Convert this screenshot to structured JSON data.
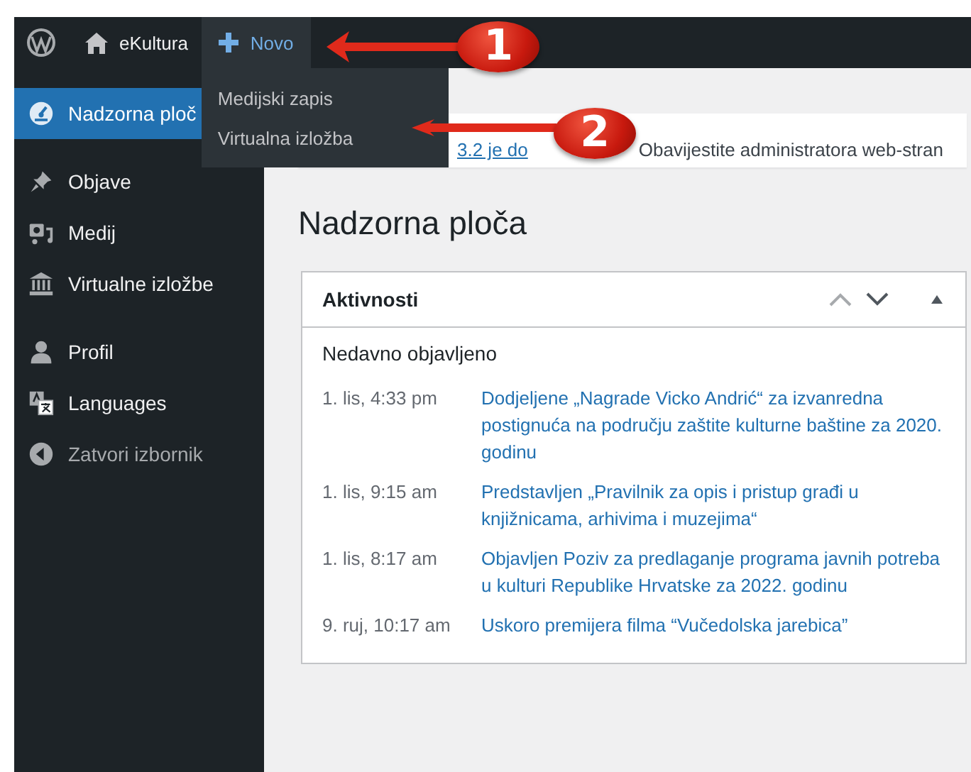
{
  "admin_bar": {
    "site_name": "eKultura",
    "new_menu": {
      "label": "Novo",
      "expanded": true,
      "items": [
        "Medijski zapis",
        "Virtualna izložba"
      ]
    }
  },
  "sidebar": {
    "groups": [
      {
        "items": [
          {
            "label": "Nadzorna ploč",
            "selected": true
          }
        ]
      },
      {
        "items": [
          {
            "label": "Objave",
            "selected": false
          },
          {
            "label": "Medij",
            "selected": false
          },
          {
            "label": "Virtualne izložbe",
            "selected": false
          }
        ]
      },
      {
        "items": [
          {
            "label": "Profil",
            "selected": false
          },
          {
            "label": "Languages",
            "selected": false
          }
        ]
      }
    ],
    "collapse_label": "Zatvori izbornik"
  },
  "notice": {
    "link": "3.2 je do",
    "text": "Obavijestite administratora web-stran"
  },
  "page_title": "Nadzorna ploča",
  "widget": {
    "title": "Aktivnosti",
    "expanded": true,
    "section_title": "Nedavno objavljeno",
    "posts": [
      {
        "date": "1. lis, 4:33 pm",
        "title": "Dodjeljene „Nagrade Vicko Andrić“ za izvanredna postignuća na području zaštite kulturne baštine za 2020. godinu"
      },
      {
        "date": "1. lis, 9:15 am",
        "title": "Predstavljen „Pravilnik za opis i pristup građi u knjižnicama, arhivima i muzejima“"
      },
      {
        "date": "1. lis, 8:17 am",
        "title": "Objavljen Poziv za predlaganje programa javnih potreba u kulturi Republike Hrvatske za 2022. godinu"
      },
      {
        "date": "9. ruj, 10:17 am",
        "title": "Uskoro premijera filma “Vučedolska jarebica”"
      }
    ]
  },
  "annotations": [
    {
      "label": "1"
    },
    {
      "label": "2"
    }
  ]
}
